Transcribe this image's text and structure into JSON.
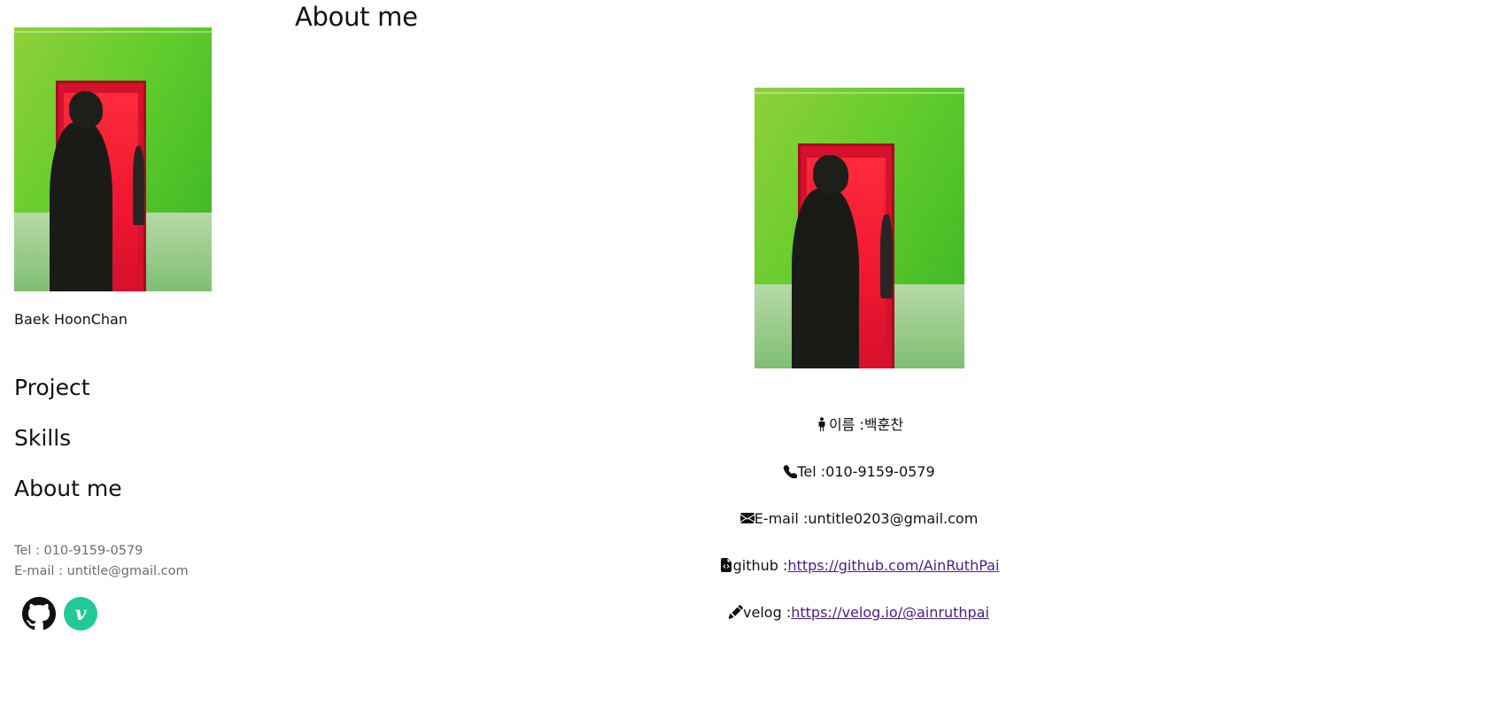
{
  "sidebar": {
    "name": "Baek HoonChan",
    "nav": [
      "Project",
      "Skills",
      "About me"
    ],
    "tel": "Tel : 010-9159-0579",
    "email": "E-mail : untitle@gmail.com",
    "social": {
      "velog_letter": "v"
    }
  },
  "main": {
    "title": "About me",
    "info": {
      "name_label": "이름 : ",
      "name_value": "백훈찬",
      "tel_label": "Tel : ",
      "tel_value": "010-9159-0579",
      "email_label": "E-mail : ",
      "email_value": "untitle0203@gmail.com",
      "github_label": "github :",
      "github_url": "https://github.com/AinRuthPai",
      "velog_label": "velog :",
      "velog_url": "https://velog.io/@ainruthpai"
    }
  },
  "colors": {
    "link": "#4b1b8f",
    "velog_brand": "#20c997",
    "muted_text": "#6b6b6b"
  },
  "icons": [
    "profile-photo",
    "github-icon",
    "velog-icon",
    "person-icon",
    "phone-icon",
    "envelope-icon",
    "file-code-icon",
    "pencil-icon"
  ]
}
